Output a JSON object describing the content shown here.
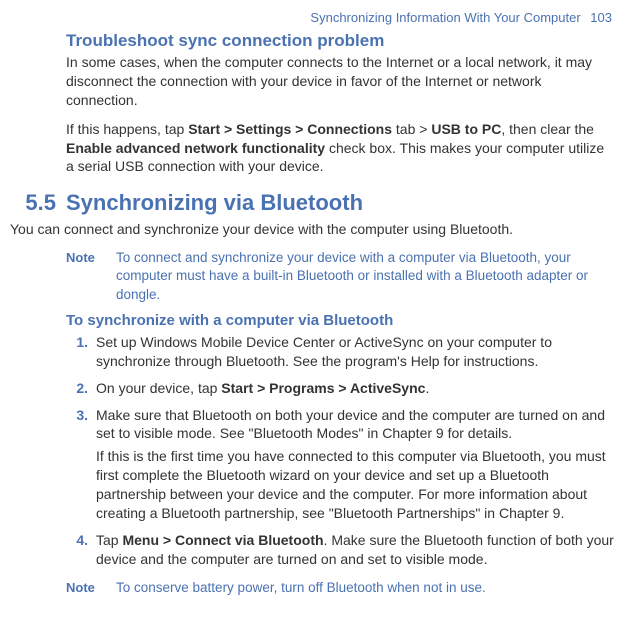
{
  "header": {
    "title": "Synchronizing Information With Your Computer",
    "page_number": "103"
  },
  "troubleshoot": {
    "heading": "Troubleshoot sync connection problem",
    "p1": "In some cases, when the computer connects to the Internet or a local network, it may disconnect the connection with your device in favor of the Internet or network connection.",
    "p2a": "If this happens, tap ",
    "p2b_strong": "Start > Settings > Connections",
    "p2c": " tab > ",
    "p2d_strong": "USB to PC",
    "p2e": ", then clear the ",
    "p2f_strong": "Enable advanced network functionality",
    "p2g": " check box. This makes your computer utilize a serial USB connection with your device."
  },
  "section": {
    "number": "5.5",
    "title": "Synchronizing via Bluetooth",
    "intro": "You can connect and synchronize your device with the computer using Bluetooth.",
    "note1_label": "Note",
    "note1_text": "To connect and synchronize your device with a computer via Bluetooth, your computer must have a built-in Bluetooth or installed with a Bluetooth adapter or dongle.",
    "proc_heading": "To synchronize with a computer via Bluetooth",
    "steps": [
      {
        "num": "1.",
        "p1": "Set up Windows Mobile Device Center or ActiveSync on your computer to synchronize through Bluetooth. See the program's Help for instructions."
      },
      {
        "num": "2.",
        "p1a": "On your device, tap ",
        "p1b_strong": "Start > Programs > ActiveSync",
        "p1c": "."
      },
      {
        "num": "3.",
        "p1": "Make sure that Bluetooth on both your device and the computer are turned on and set to visible mode. See \"Bluetooth Modes\" in Chapter 9 for details.",
        "p2": "If this is the first time you have connected to this computer via Bluetooth, you must first complete the Bluetooth wizard on your device and set up a Bluetooth partnership between your device and the computer. For more information about creating a Bluetooth partnership, see \"Bluetooth Partnerships\" in Chapter 9."
      },
      {
        "num": "4.",
        "p1a": "Tap ",
        "p1b_strong": "Menu > Connect via Bluetooth",
        "p1c": ". Make sure the Bluetooth function of both your device and the computer are turned on and set to visible mode."
      }
    ],
    "note2_label": "Note",
    "note2_text": "To conserve battery power, turn off Bluetooth when not in use."
  }
}
